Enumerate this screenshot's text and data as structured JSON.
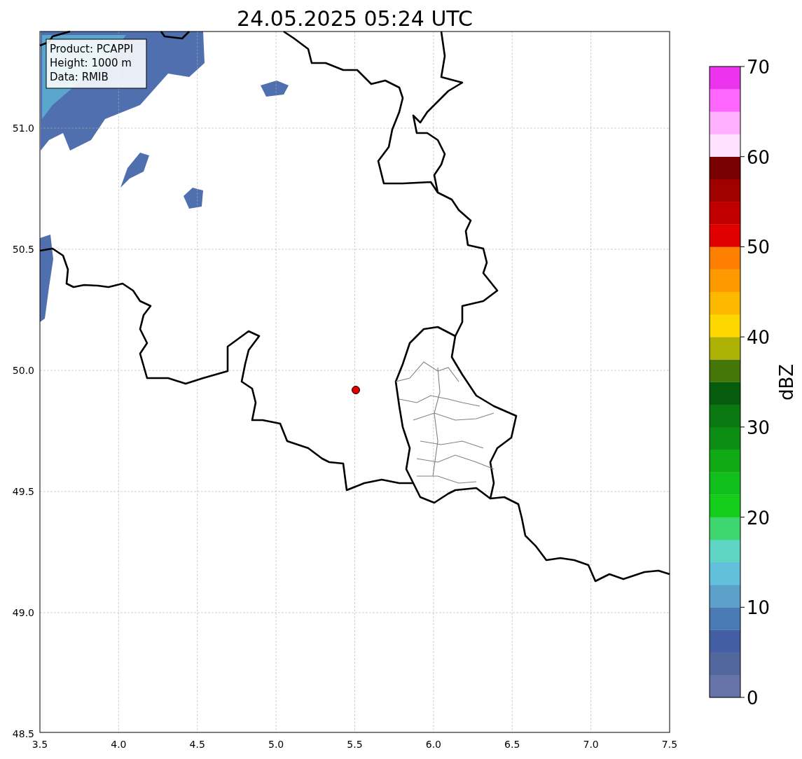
{
  "title": "24.05.2025 05:24 UTC",
  "info_box": {
    "lines": [
      "Product: PCAPPI",
      "Height: 1000 m",
      "Data: RMIB"
    ]
  },
  "map": {
    "x_ticks": [
      "3.5",
      "4.0",
      "4.5",
      "5.0",
      "5.5",
      "6.0",
      "6.5",
      "7.0",
      "7.5"
    ],
    "y_ticks": [
      "51.0",
      "50.5",
      "50.0",
      "49.5",
      "49.0",
      "48.5"
    ]
  },
  "colorbar": {
    "label": "dBZ",
    "ticks": [
      "70",
      "60",
      "50",
      "40",
      "30",
      "20",
      "10",
      "0"
    ],
    "bands": [
      {
        "color": "#6573a8"
      },
      {
        "color": "#53679f"
      },
      {
        "color": "#435ea3"
      },
      {
        "color": "#4a7ab4"
      },
      {
        "color": "#5aa0c8"
      },
      {
        "color": "#63c0dc"
      },
      {
        "color": "#5fd6c5"
      },
      {
        "color": "#3dd66f"
      },
      {
        "color": "#14cc1a"
      },
      {
        "color": "#11bf1c"
      },
      {
        "color": "#10aa14"
      },
      {
        "color": "#0c8e14"
      },
      {
        "color": "#0a7810"
      },
      {
        "color": "#065c0c"
      },
      {
        "color": "#457708"
      },
      {
        "color": "#adb104"
      },
      {
        "color": "#ffd700"
      },
      {
        "color": "#ffb800"
      },
      {
        "color": "#ff9900"
      },
      {
        "color": "#ff7f00"
      },
      {
        "color": "#e00000"
      },
      {
        "color": "#c00000"
      },
      {
        "color": "#a00000"
      },
      {
        "color": "#780000"
      },
      {
        "color": "#ffe0ff"
      },
      {
        "color": "#ffb0ff"
      },
      {
        "color": "#ff66ff"
      },
      {
        "color": "#ee33ee"
      }
    ]
  }
}
